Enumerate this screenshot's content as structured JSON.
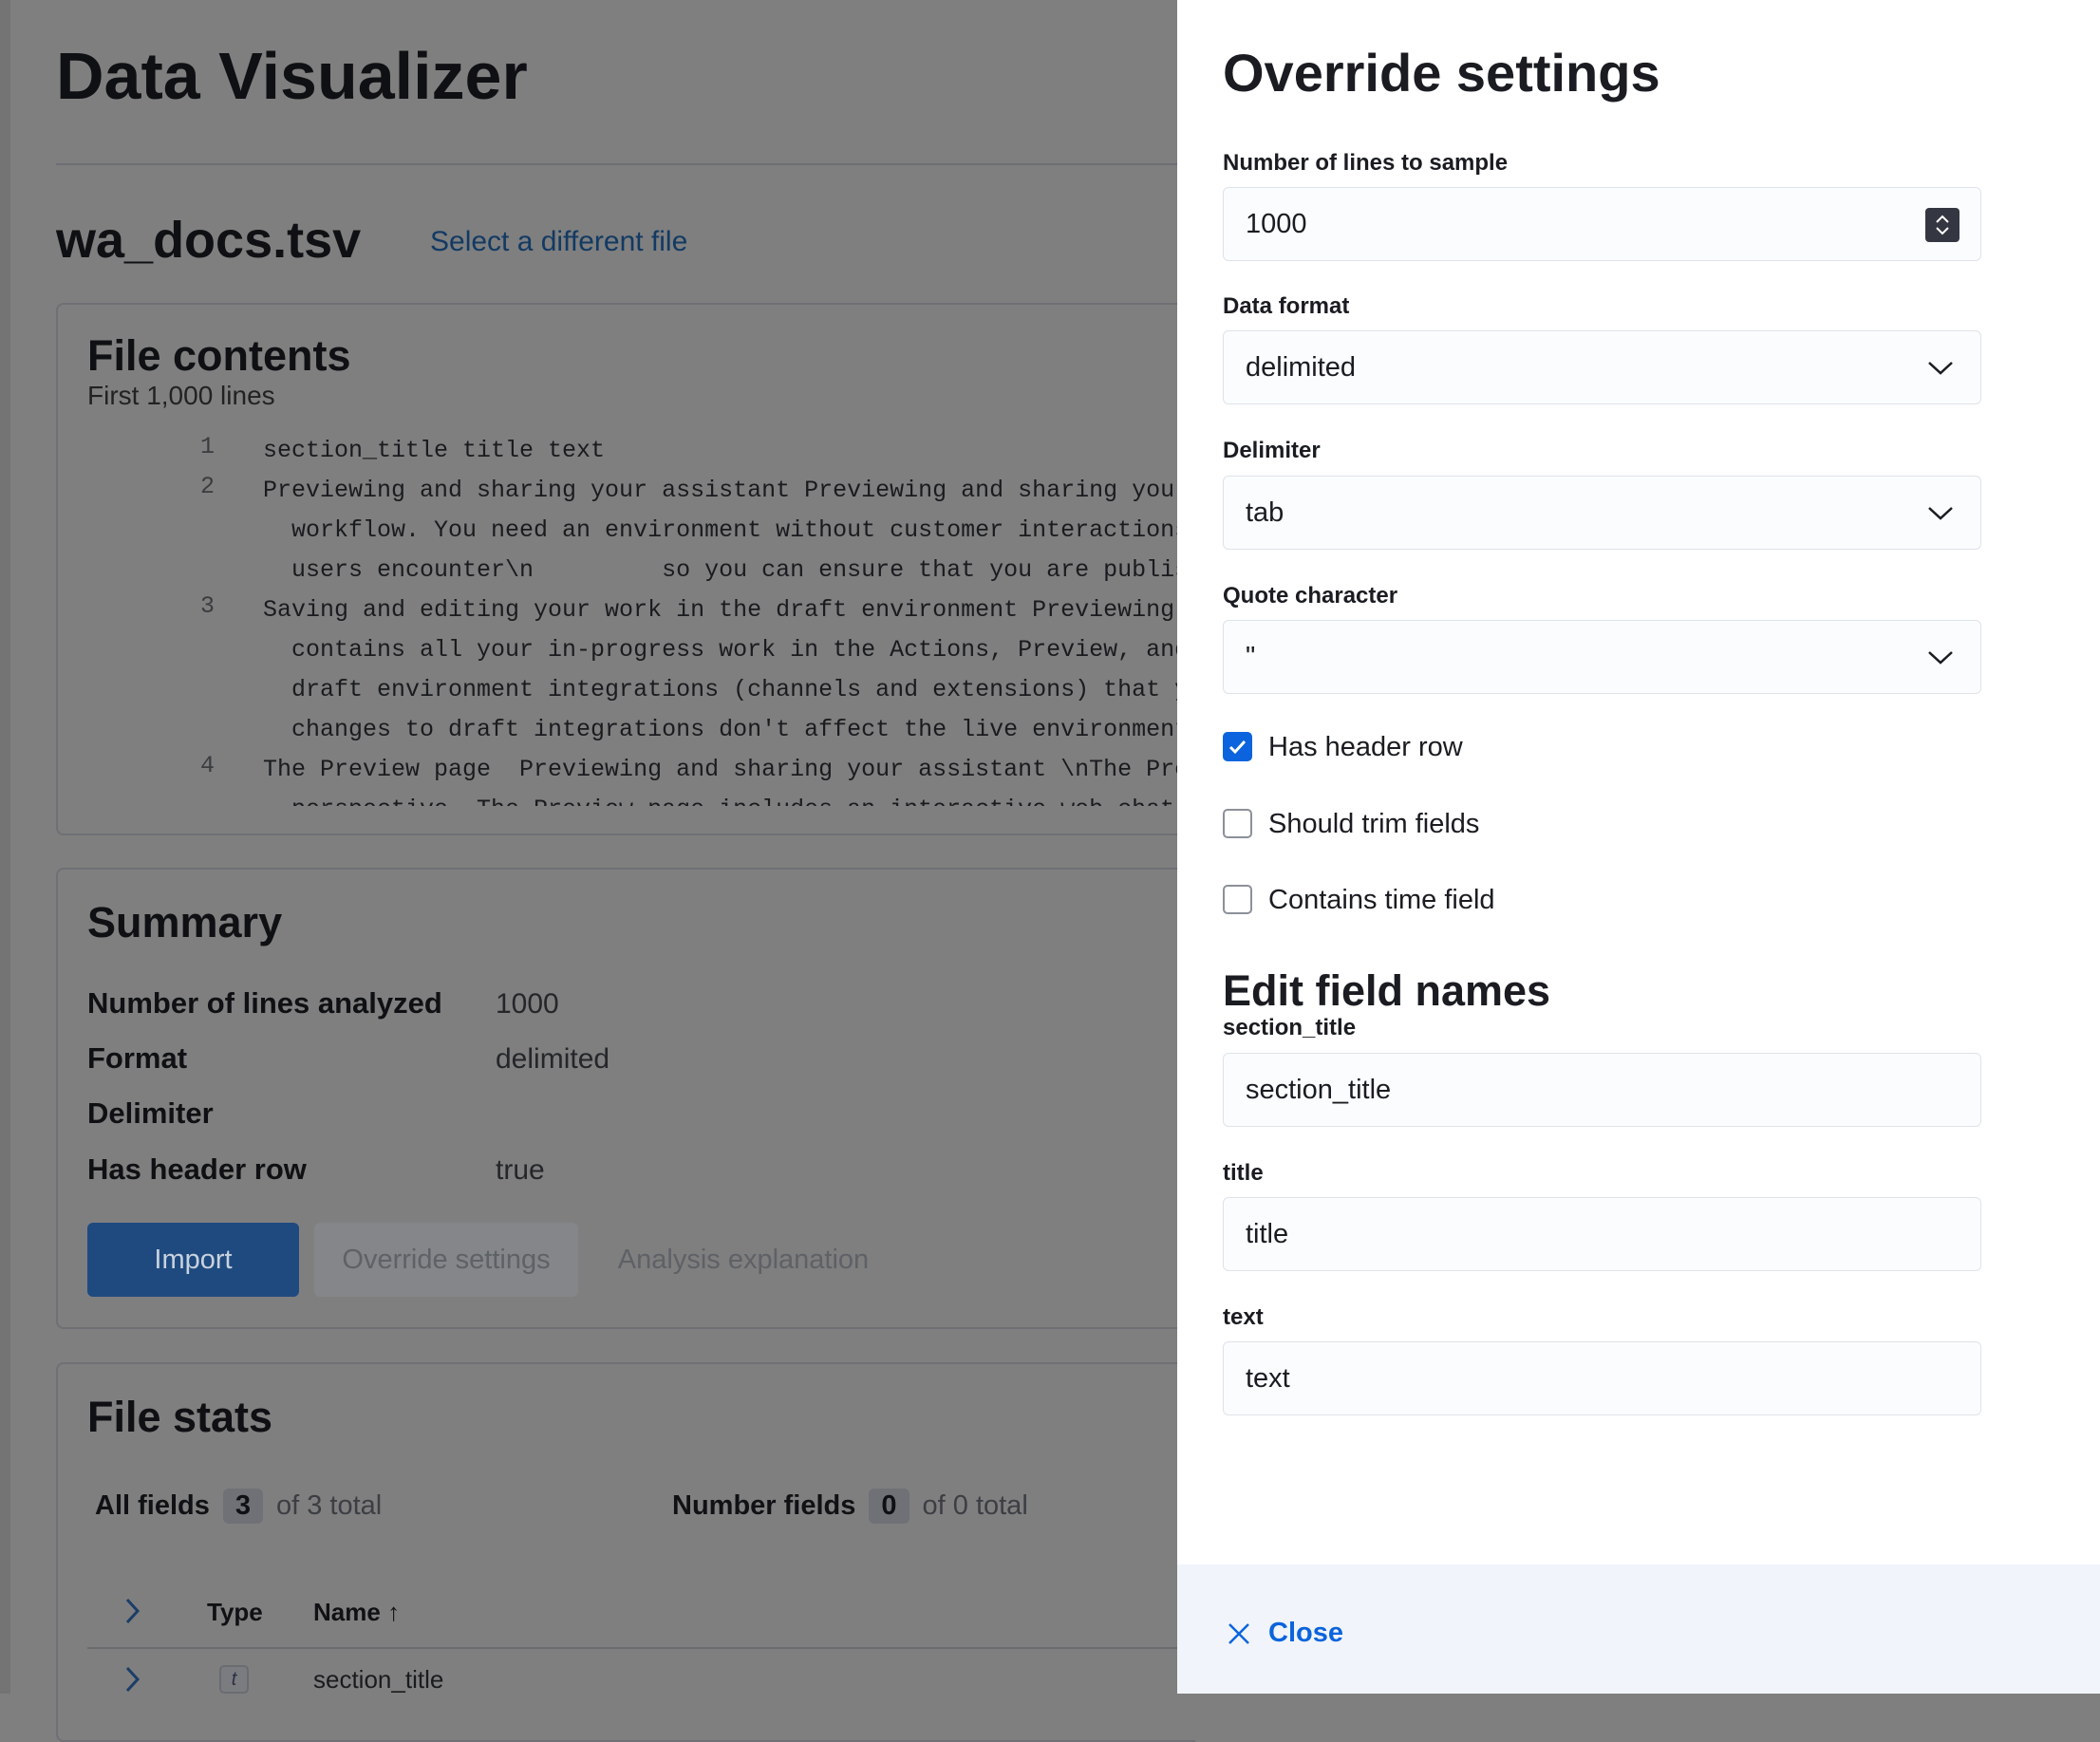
{
  "page": {
    "title": "Data Visualizer",
    "file_name": "wa_docs.tsv",
    "select_file_link": "Select a different file"
  },
  "file_contents": {
    "title": "File contents",
    "subtitle": "First 1,000 lines",
    "lines": [
      {
        "num": "1",
        "text": [
          "section_title title text"
        ]
      },
      {
        "num": "2",
        "text": [
          "Previewing and sharing your assistant Previewing and sharing your assis",
          "  workflow. You need an environment without customer interactions so yo",
          "  users encounter\\n         so you can ensure that you are publishing"
        ]
      },
      {
        "num": "3",
        "text": [
          "Saving and editing your work in the draft environment Previewing and sh",
          "  contains all your in-progress work in the Actions, Preview, and Publi",
          "  draft environment integrations (channels and extensions) that you can",
          "  changes to draft integrations don't affect the live environment.\\n"
        ]
      },
      {
        "num": "4",
        "text": [
          "The Preview page  Previewing and sharing your assistant \\nThe Preview p",
          "  perspective. The Preview page includes an interactive web chat widget"
        ]
      }
    ]
  },
  "summary": {
    "title": "Summary",
    "rows": [
      {
        "label": "Number of lines analyzed",
        "value": "1000"
      },
      {
        "label": "Format",
        "value": "delimited"
      },
      {
        "label": "Delimiter",
        "value": ""
      },
      {
        "label": "Has header row",
        "value": "true"
      }
    ],
    "import_button": "Import",
    "override_button": "Override settings",
    "analysis_button": "Analysis explanation"
  },
  "file_stats": {
    "title": "File stats",
    "all_fields_label": "All fields",
    "all_fields_count": "3",
    "all_fields_total": "of 3 total",
    "number_fields_label": "Number fields",
    "number_fields_count": "0",
    "number_fields_total": "of 0 total",
    "col_type": "Type",
    "col_name": "Name",
    "row_type": "t",
    "row_name": "section_title"
  },
  "flyout": {
    "title": "Override settings",
    "lines_label": "Number of lines to sample",
    "lines_value": "1000",
    "format_label": "Data format",
    "format_value": "delimited",
    "delimiter_label": "Delimiter",
    "delimiter_value": "tab",
    "quote_label": "Quote character",
    "quote_value": "\"",
    "checkboxes": [
      {
        "label": "Has header row",
        "checked": true
      },
      {
        "label": "Should trim fields",
        "checked": false
      },
      {
        "label": "Contains time field",
        "checked": false
      }
    ],
    "edit_title": "Edit field names",
    "fields": [
      {
        "label": "section_title",
        "value": "section_title"
      },
      {
        "label": "title",
        "value": "title"
      },
      {
        "label": "text",
        "value": "text"
      }
    ],
    "close_label": "Close"
  },
  "colors": {
    "accent": "#07c",
    "primary_button": "#1f4e8c",
    "link": "#0b64dd"
  }
}
